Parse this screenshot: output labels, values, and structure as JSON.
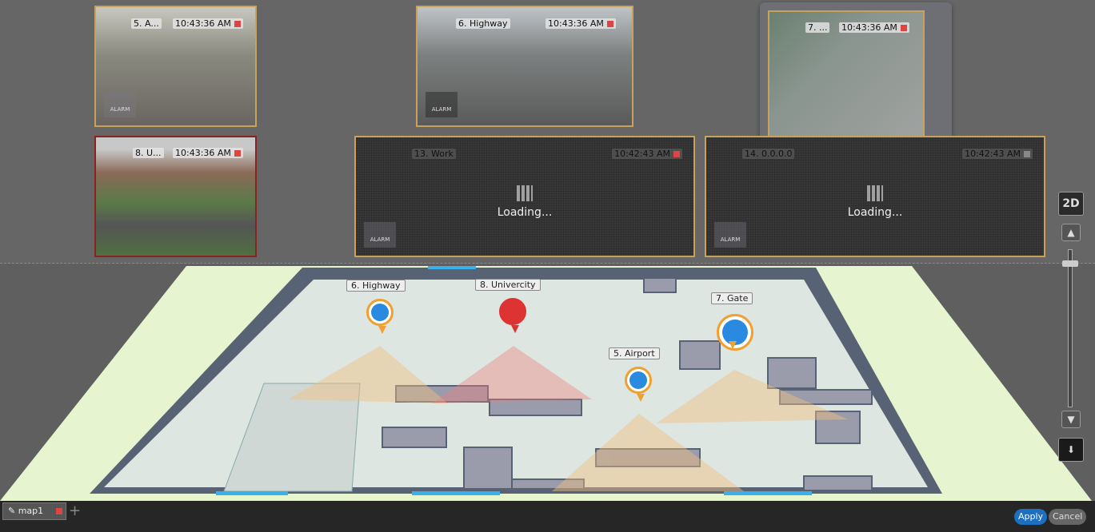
{
  "tiles": [
    {
      "name": "5. A...",
      "time": "10:43:36 AM",
      "alarm": "ALARM"
    },
    {
      "name": "6. Highway",
      "time": "10:43:36 AM",
      "alarm": "ALARM"
    },
    {
      "name": "7. ...",
      "time": "10:43:36 AM"
    },
    {
      "name": "8. U...",
      "time": "10:43:36 AM"
    },
    {
      "name": "13. Work",
      "time": "10:42:43 AM",
      "status": "Loading...",
      "alarm": "ALARM"
    },
    {
      "name": "14. 0.0.0.0",
      "time": "10:42:43 AM",
      "status": "Loading...",
      "alarm": "ALARM"
    }
  ],
  "controls": {
    "mode": "2D",
    "up": "▲",
    "down": "▼",
    "download": "⬇"
  },
  "map_cameras": [
    {
      "label": "6. Highway",
      "state": "normal"
    },
    {
      "label": "8. Univercity",
      "state": "alarm"
    },
    {
      "label": "7. Gate",
      "state": "selected"
    },
    {
      "label": "5. Airport",
      "state": "normal"
    }
  ],
  "colors": {
    "accent": "#f0a030",
    "alarm": "#d33333",
    "camera": "#2a8ae0",
    "floor": "#e6f5cf"
  },
  "bottom": {
    "tab": "map1",
    "apply": "Apply",
    "cancel": "Cancel"
  }
}
